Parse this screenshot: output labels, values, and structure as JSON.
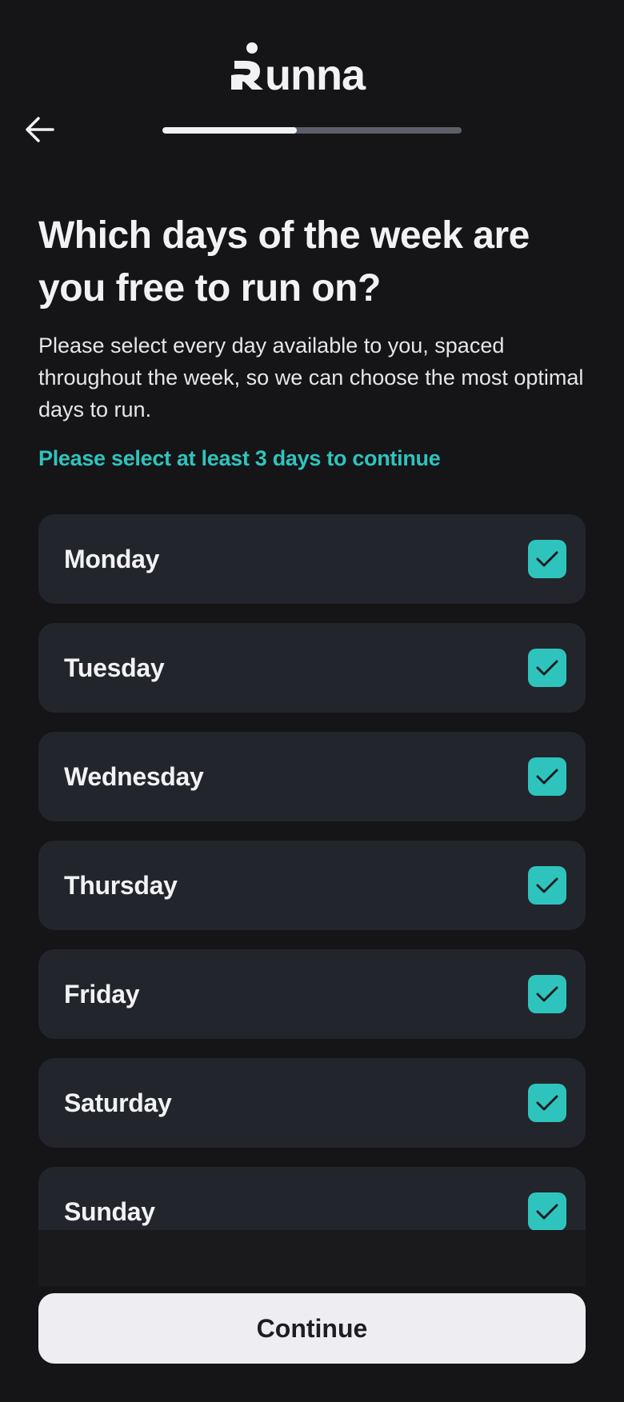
{
  "header": {
    "logo_text": "Runna",
    "progress": 0.45
  },
  "content": {
    "title": "Which days of the week are you free to run on?",
    "subtitle": "Please select every day available to you, spaced throughout the week, so we can choose the most optimal days to run.",
    "hint": "Please select at least 3 days to continue"
  },
  "days": [
    {
      "label": "Monday",
      "checked": true
    },
    {
      "label": "Tuesday",
      "checked": true
    },
    {
      "label": "Wednesday",
      "checked": true
    },
    {
      "label": "Thursday",
      "checked": true
    },
    {
      "label": "Friday",
      "checked": true
    },
    {
      "label": "Saturday",
      "checked": true
    },
    {
      "label": "Sunday",
      "checked": true
    }
  ],
  "footer": {
    "continue_label": "Continue"
  },
  "colors": {
    "background": "#151417",
    "accent": "#2ec4bd",
    "card": "#22252c"
  }
}
